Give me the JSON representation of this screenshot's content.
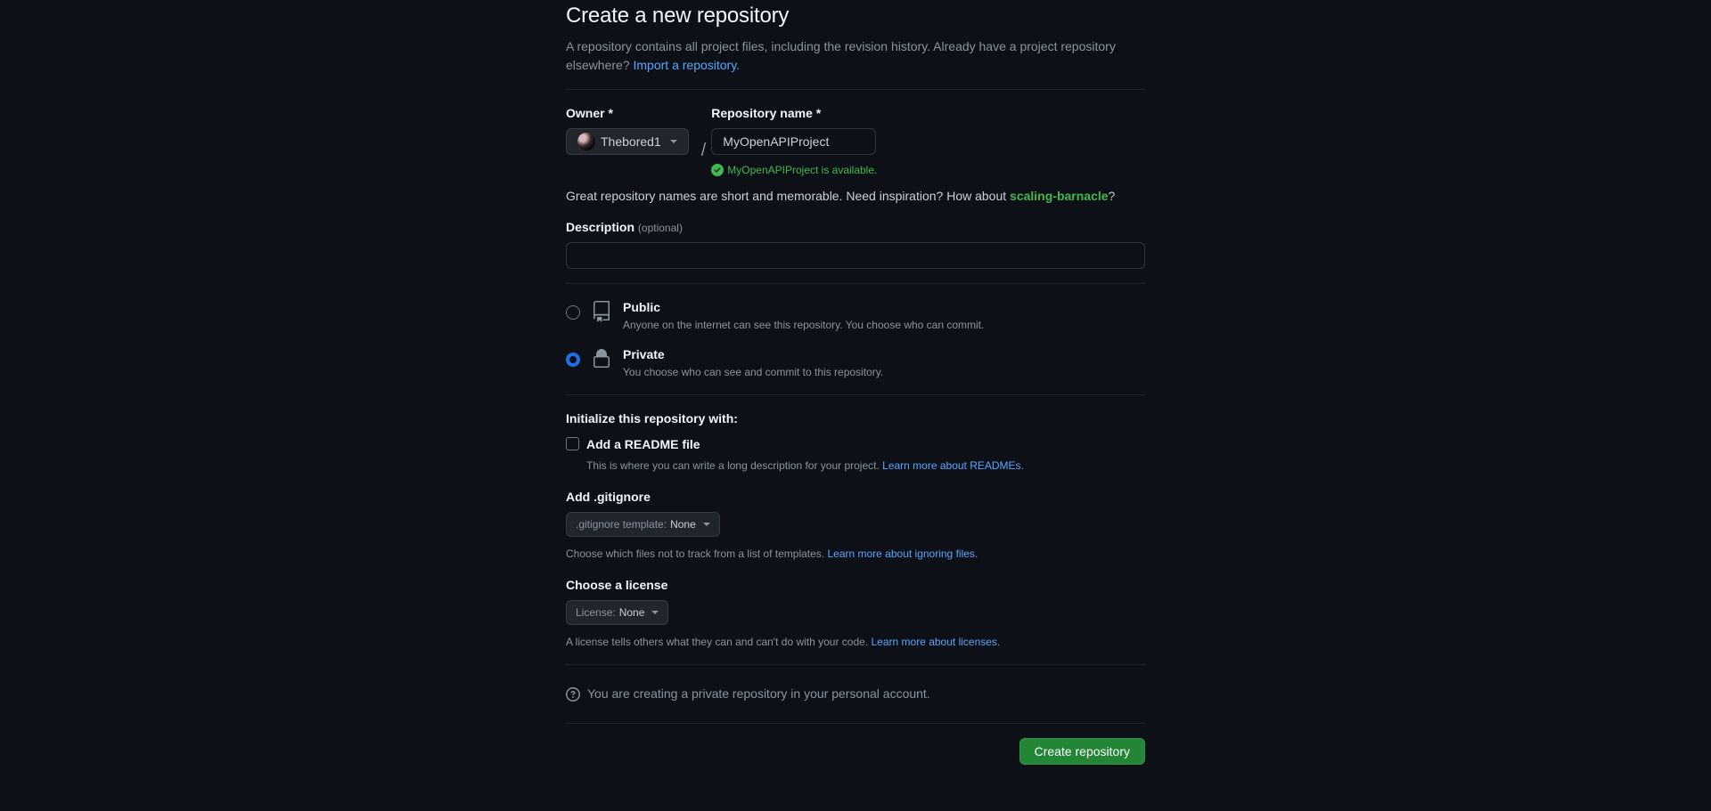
{
  "heading": "Create a new repository",
  "subhead_text": "A repository contains all project files, including the revision history. Already have a project repository elsewhere? ",
  "import_link": "Import a repository.",
  "owner": {
    "label": "Owner *",
    "name": "Thebored1"
  },
  "repo": {
    "label": "Repository name *",
    "value": "MyOpenAPIProject",
    "availability": "MyOpenAPIProject is available."
  },
  "inspire": {
    "prefix": "Great repository names are short and memorable. Need inspiration? How about ",
    "suggestion": "scaling-barnacle",
    "suffix": "?"
  },
  "description": {
    "label": "Description",
    "optional": "(optional)",
    "value": ""
  },
  "visibility": {
    "public": {
      "title": "Public",
      "sub": "Anyone on the internet can see this repository. You choose who can commit."
    },
    "private": {
      "title": "Private",
      "sub": "You choose who can see and commit to this repository."
    }
  },
  "init": {
    "heading": "Initialize this repository with:",
    "readme": {
      "label": "Add a README file",
      "sub": "This is where you can write a long description for your project. ",
      "link": "Learn more about READMEs",
      "period": "."
    },
    "gitignore": {
      "heading": "Add .gitignore",
      "prefix": ".gitignore template:",
      "value": "None",
      "help": "Choose which files not to track from a list of templates. ",
      "link": "Learn more about ignoring files",
      "period": "."
    },
    "license": {
      "heading": "Choose a license",
      "prefix": "License:",
      "value": "None",
      "help": "A license tells others what they can and can't do with your code. ",
      "link": "Learn more about licenses",
      "period": "."
    }
  },
  "notice": "You are creating a private repository in your personal account.",
  "create_button": "Create repository"
}
